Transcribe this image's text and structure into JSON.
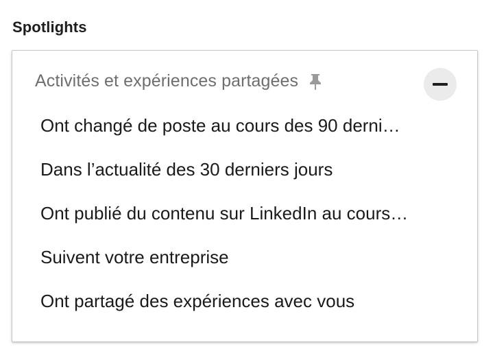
{
  "section": {
    "label": "Spotlights"
  },
  "group": {
    "title": "Activités et expériences partagées",
    "pin_icon": "pin-icon",
    "collapse_icon": "minus-icon"
  },
  "options": [
    {
      "label": "Ont changé de poste au cours des 90 derni…"
    },
    {
      "label": "Dans l’actualité des 30 derniers jours"
    },
    {
      "label": "Ont publié du contenu sur LinkedIn au cours…"
    },
    {
      "label": "Suivent votre entreprise"
    },
    {
      "label": "Ont partagé des expériences avec vous"
    }
  ],
  "colors": {
    "group_title": "#6e6e6e",
    "option_text": "#1a1a1a",
    "collapse_bg": "#ebebeb",
    "pin": "#9a9a9a"
  }
}
